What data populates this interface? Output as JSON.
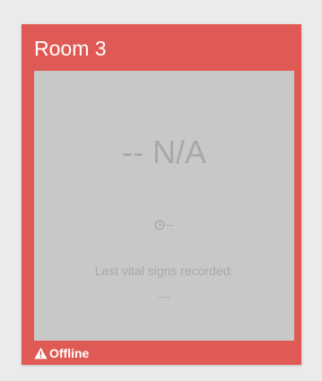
{
  "room": {
    "title": "Room 3",
    "status_color": "#e05a55"
  },
  "vitals": {
    "heart_rate": "-- N/A",
    "time_icon": "clock-icon",
    "time_value": "--",
    "last_recorded_label": "Last vital signs recorded:",
    "last_recorded_value": "---",
    "panel_color": "#c8c8c8"
  },
  "status": {
    "icon": "warning-icon",
    "label": "Offline"
  }
}
